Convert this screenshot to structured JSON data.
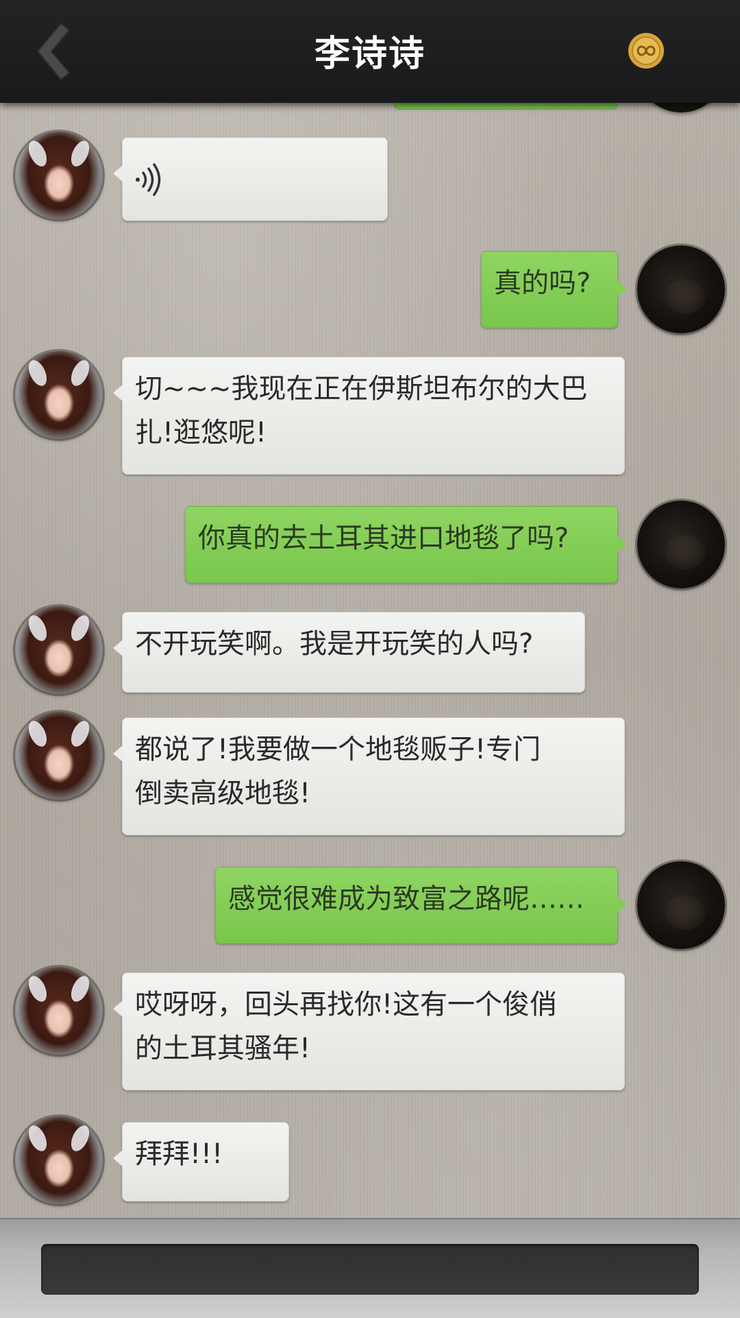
{
  "header": {
    "title": "李诗诗",
    "back_icon": "chevron-left-icon",
    "coin_icon": "infinity-coin-icon"
  },
  "colors": {
    "header_bg": "#1e1e1e",
    "bubble_left": "#ececea",
    "bubble_right": "#82cd55",
    "footer_input": "#333333"
  },
  "messages": [
    {
      "side": "left",
      "type": "voice",
      "icon": "voice-icon",
      "text": ""
    },
    {
      "side": "right",
      "type": "text",
      "text": "真的吗?"
    },
    {
      "side": "left",
      "type": "text",
      "lines": [
        "切~~~我现在正在伊斯坦布尔的大巴",
        "扎!逛悠呢!"
      ]
    },
    {
      "side": "right",
      "type": "text",
      "text": "你真的去土耳其进口地毯了吗?"
    },
    {
      "side": "left",
      "type": "text",
      "text": "不开玩笑啊。我是开玩笑的人吗?"
    },
    {
      "side": "left",
      "type": "text",
      "lines": [
        "都说了!我要做一个地毯贩子!专门",
        "倒卖高级地毯!"
      ]
    },
    {
      "side": "right",
      "type": "text",
      "text": "感觉很难成为致富之路呢……"
    },
    {
      "side": "left",
      "type": "text",
      "lines": [
        "哎呀呀，回头再找你!这有一个俊俏",
        "的土耳其骚年!"
      ]
    },
    {
      "side": "left",
      "type": "text",
      "text": "拜拜!!!"
    }
  ],
  "footer": {
    "input_value": ""
  }
}
